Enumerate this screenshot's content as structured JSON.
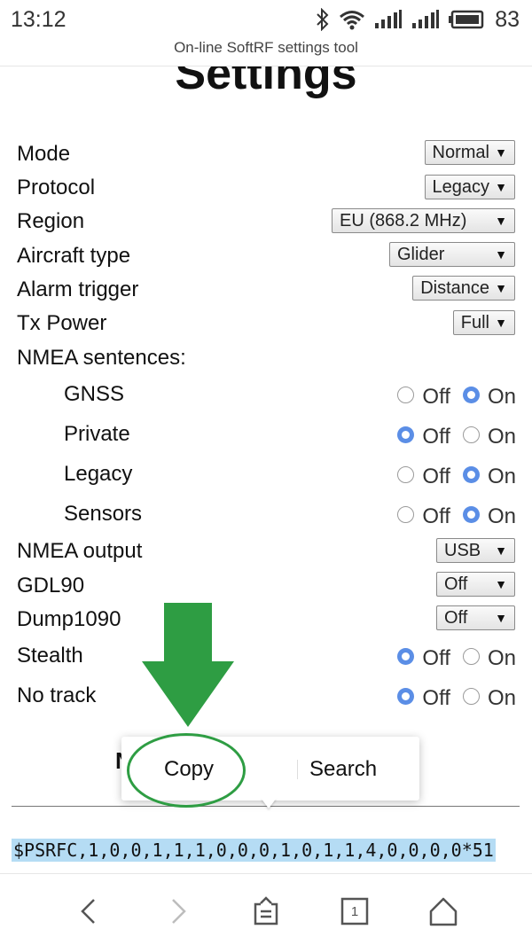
{
  "status_bar": {
    "time": "13:12",
    "battery": "83"
  },
  "browser": {
    "title": "On-line SoftRF settings tool",
    "tab_count": "1"
  },
  "page": {
    "heading": "Settings",
    "fields": {
      "mode": {
        "label": "Mode",
        "value": "Normal"
      },
      "protocol": {
        "label": "Protocol",
        "value": "Legacy"
      },
      "region": {
        "label": "Region",
        "value": "EU (868.2 MHz)"
      },
      "aircraft_type": {
        "label": "Aircraft type",
        "value": "Glider"
      },
      "alarm_trigger": {
        "label": "Alarm trigger",
        "value": "Distance"
      },
      "tx_power": {
        "label": "Tx Power",
        "value": "Full"
      },
      "nmea_sentences": {
        "label": "NMEA sentences:"
      },
      "gnss": {
        "label": "GNSS",
        "off": "Off",
        "on": "On",
        "selected": "On"
      },
      "private": {
        "label": "Private",
        "off": "Off",
        "on": "On",
        "selected": "Off"
      },
      "legacy": {
        "label": "Legacy",
        "off": "Off",
        "on": "On",
        "selected": "On"
      },
      "sensors": {
        "label": "Sensors",
        "off": "Off",
        "on": "On",
        "selected": "On"
      },
      "nmea_output": {
        "label": "NMEA output",
        "value": "USB"
      },
      "gdl90": {
        "label": "GDL90",
        "value": "Off"
      },
      "dump1090": {
        "label": "Dump1090",
        "value": "Off"
      },
      "stealth": {
        "label": "Stealth",
        "off": "Off",
        "on": "On",
        "selected": "Off"
      },
      "no_track": {
        "label": "No track",
        "off": "Off",
        "on": "On",
        "selected": "Off"
      }
    },
    "partial_text": "N",
    "output": "$PSRFC,1,0,0,1,1,1,0,0,0,1,0,1,1,4,0,0,0,0*51"
  },
  "context_menu": {
    "copy": "Copy",
    "search": "Search"
  },
  "icons": [
    "bluetooth-icon",
    "wifi-icon",
    "signal-icon",
    "battery-icon",
    "back-icon",
    "forward-icon",
    "share-icon",
    "tabs-icon",
    "home-icon"
  ],
  "colors": {
    "radio_selected": "#5b8ee6",
    "highlight": "#b5dcf4",
    "annotation": "#2e9d43"
  }
}
